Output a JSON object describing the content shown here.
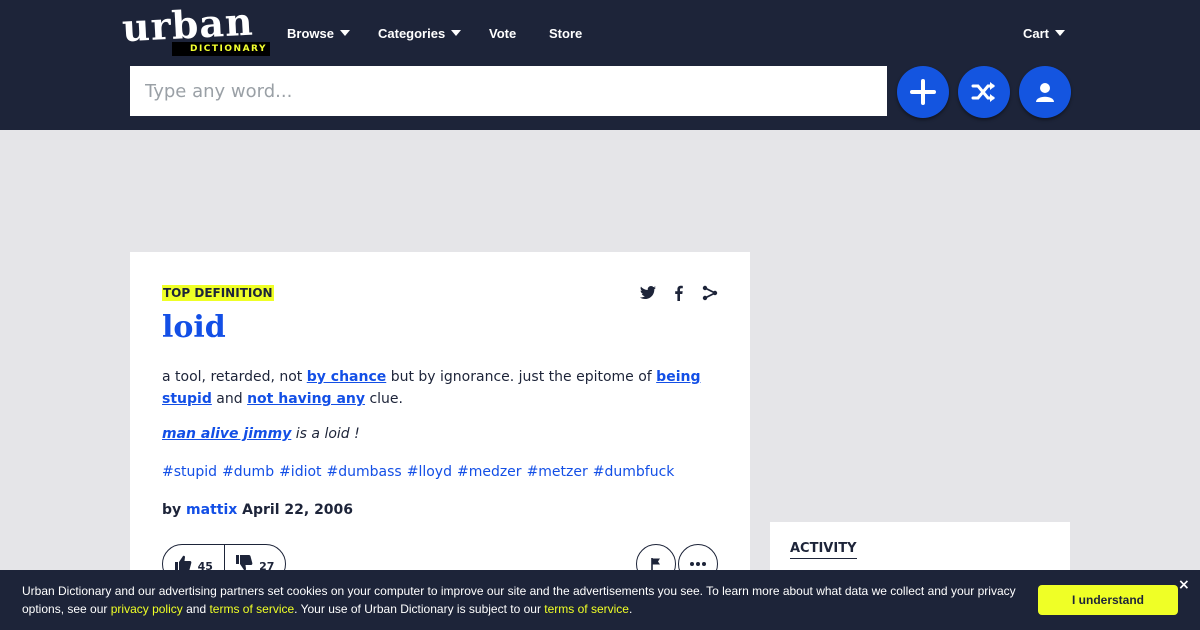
{
  "logo": {
    "main": "urban",
    "sub": "DICTIONARY"
  },
  "nav": [
    {
      "label": "Browse",
      "dropdown": true
    },
    {
      "label": "Categories",
      "dropdown": true
    },
    {
      "label": "Vote",
      "dropdown": false
    },
    {
      "label": "Store",
      "dropdown": false
    }
  ],
  "cart": {
    "label": "Cart"
  },
  "search": {
    "placeholder": "Type any word..."
  },
  "header_buttons": [
    "add-icon",
    "shuffle-icon",
    "user-icon"
  ],
  "colors": {
    "header_bg": "#1d2439",
    "accent_blue": "#134fe6",
    "highlight_yellow": "#efff26",
    "page_bg": "#e5e5e8"
  },
  "definition": {
    "badge": "TOP DEFINITION",
    "word": "loid",
    "meaning": {
      "t1": "a tool, retarded, not ",
      "l1": "by chance",
      "t2": " but by ignorance. just the epitome of ",
      "l2": "being stupid",
      "t3": " and ",
      "l3": "not having any",
      "t4": " clue."
    },
    "example": {
      "link": "man alive jimmy",
      "text": " is a loid !"
    },
    "tags": [
      "#stupid",
      "#dumb",
      "#idiot",
      "#dumbass",
      "#lloyd",
      "#medzer",
      "#metzer",
      "#dumbfuck"
    ],
    "byline": {
      "by": "by",
      "author": "mattix",
      "date": "April 22, 2006"
    },
    "upvotes": "45",
    "downvotes": "27",
    "share_icons": [
      "twitter-icon",
      "facebook-icon",
      "share-icon"
    ]
  },
  "activity": {
    "title": "ACTIVITY"
  },
  "cookie": {
    "text1": "Urban Dictionary and our advertising partners set cookies on your computer to improve our site and the advertisements you see. To learn more about what data we collect and your privacy options, see our ",
    "link1": "privacy policy",
    "text2": " and ",
    "link2": "terms of service",
    "text3": ". Your use of Urban Dictionary is subject to our ",
    "link3": "terms of service",
    "text4": ".",
    "button": "I understand",
    "close": "×"
  }
}
